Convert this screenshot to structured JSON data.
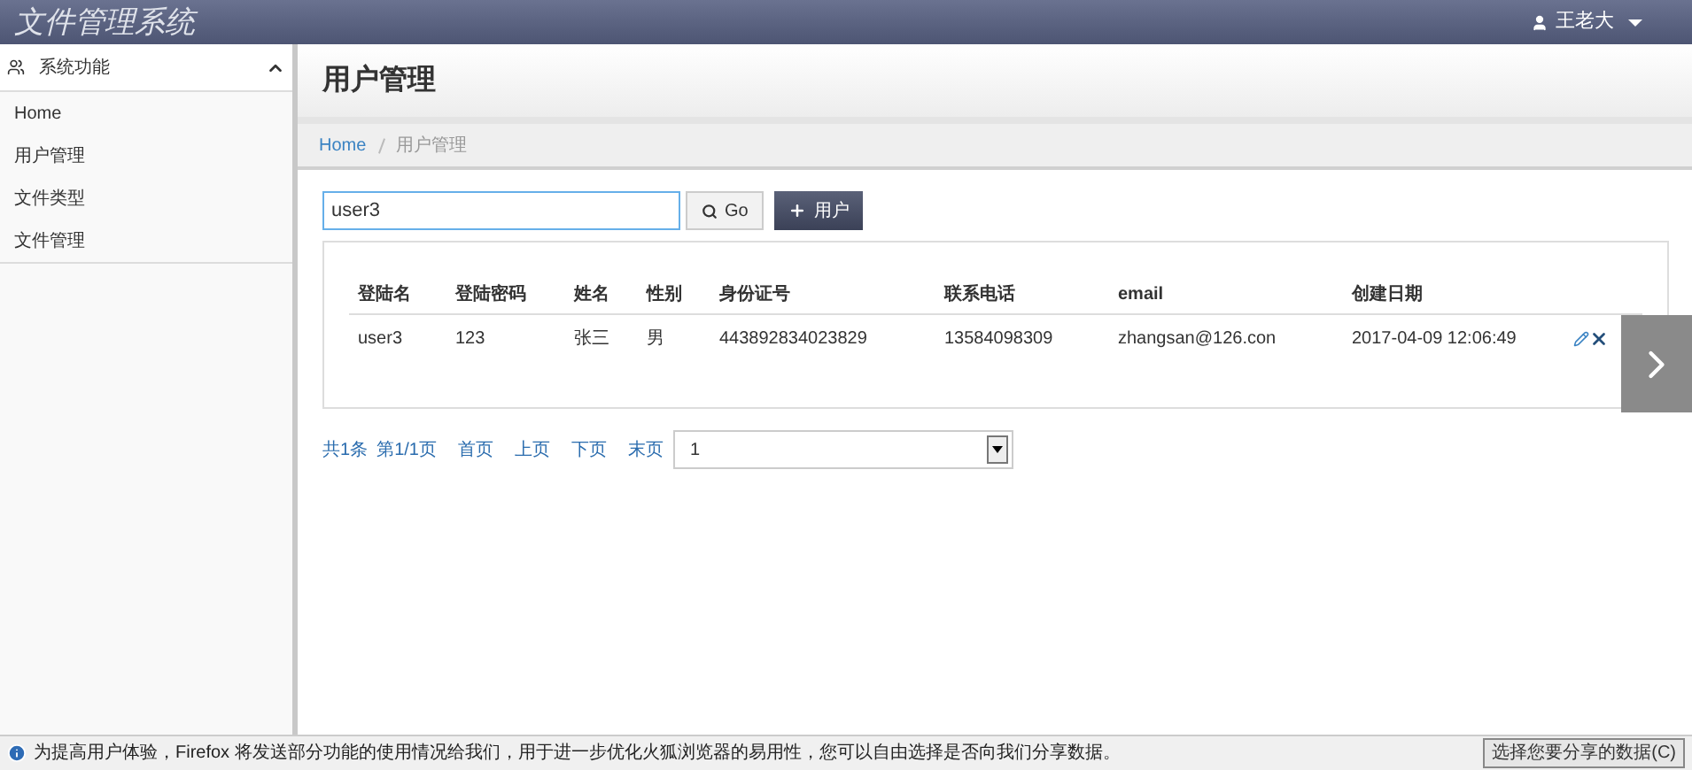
{
  "header": {
    "title": "文件管理系统",
    "user": "王老大"
  },
  "sidebar": {
    "section": {
      "label": "系统功能",
      "expanded": true
    },
    "items": [
      {
        "label": "Home"
      },
      {
        "label": "用户管理"
      },
      {
        "label": "文件类型"
      },
      {
        "label": "文件管理"
      }
    ]
  },
  "page": {
    "title": "用户管理",
    "breadcrumb": [
      "Home",
      "用户管理"
    ]
  },
  "search": {
    "value": "user3",
    "go_label": "Go",
    "add_label": "用户"
  },
  "table": {
    "columns": [
      "登陆名",
      "登陆密码",
      "姓名",
      "性别",
      "身份证号",
      "联系电话",
      "email",
      "创建日期"
    ],
    "rows": [
      [
        "user3",
        "123",
        "张三",
        "男",
        "443892834023829",
        "13584098309",
        "zhangsan@126.con",
        "2017-04-09 12:06:49"
      ]
    ]
  },
  "pagination": {
    "total": "共1条",
    "page": "第1/1页",
    "links": [
      "首页",
      "上页",
      "下页",
      "末页"
    ],
    "page_select": "1"
  },
  "notification": {
    "message": "为提高用户体验，Firefox 将发送部分功能的使用情况给我们，用于进一步优化火狐浏览器的易用性，您可以自由选择是否向我们分享数据。",
    "button": "选择您要分享的数据(C)"
  }
}
